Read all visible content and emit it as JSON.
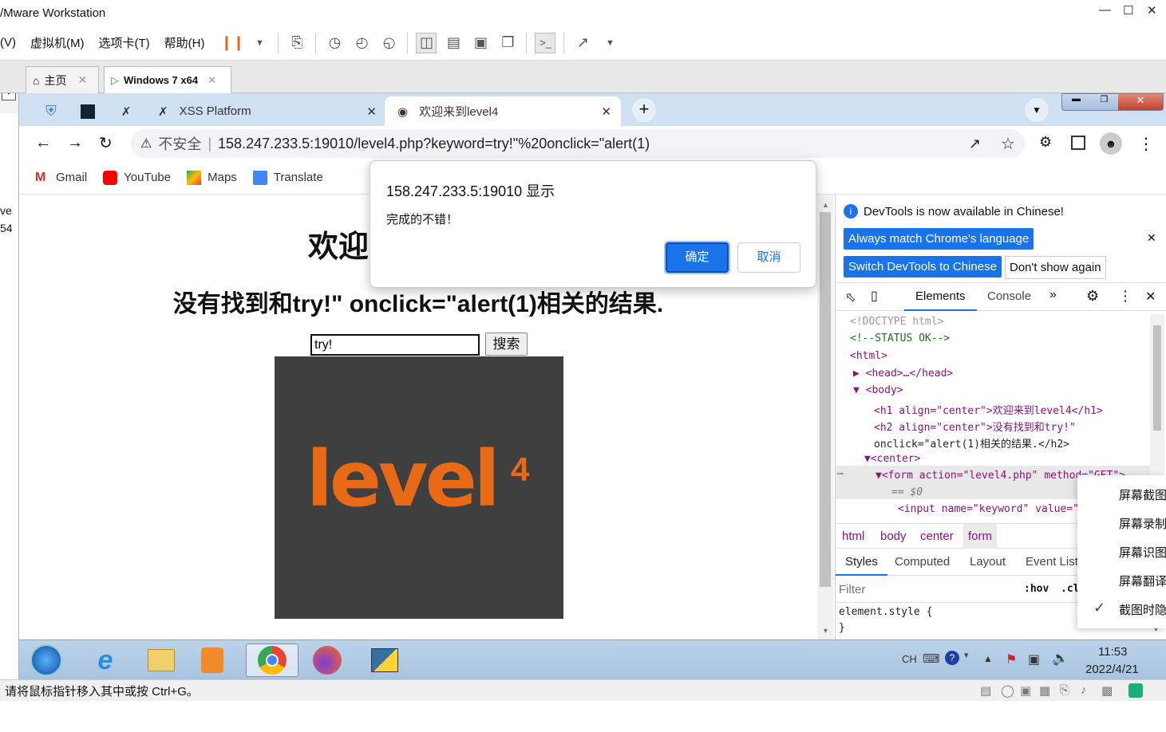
{
  "vmware": {
    "title": "/Mware Workstation",
    "menu": [
      "(V)",
      "虚拟机(M)",
      "选项卡(T)",
      "帮助(H)"
    ],
    "tabs": [
      {
        "label": "主页"
      },
      {
        "label": "Windows 7 x64"
      }
    ],
    "left_labels": [
      "ve",
      "54"
    ],
    "status": "请将鼠标指针移入其中或按 Ctrl+G。"
  },
  "chrome": {
    "tabs": [
      {
        "label": ""
      },
      {
        "label": ""
      },
      {
        "label": ""
      },
      {
        "label": "XSS Platform"
      },
      {
        "label": "欢迎来到level4"
      }
    ],
    "not_secure": "不安全",
    "url": "158.247.233.5:19010/level4.php?keyword=try!\"%20onclick=\"alert(1)",
    "bookmarks": [
      {
        "label": "Gmail",
        "icon": "gmail-icon"
      },
      {
        "label": "YouTube",
        "icon": "youtube-icon"
      },
      {
        "label": "Maps",
        "icon": "maps-icon"
      },
      {
        "label": "Translate",
        "icon": "translate-icon"
      }
    ]
  },
  "page": {
    "h1": "欢迎",
    "h2": "没有找到和try!\" onclick=\"alert(1)相关的结果.",
    "input_value": "try!",
    "search_button": "搜索",
    "image_text": "level",
    "image_sup": "4"
  },
  "alert": {
    "title": "158.247.233.5:19010 显示",
    "message": "完成的不错！",
    "ok": "确定",
    "cancel": "取消"
  },
  "devtools": {
    "info": "DevTools is now available in Chinese!",
    "btn_match": "Always match Chrome's language",
    "btn_switch": "Switch DevTools to Chinese",
    "btn_dont": "Don't show again",
    "tabs": [
      "Elements",
      "Console"
    ],
    "dom_lines": [
      "<!DOCTYPE html>",
      "<!--STATUS OK-->",
      "<html>",
      "<head>…</head>",
      "<body>",
      "<h1 align=\"center\">欢迎来到level4</h1>",
      "<h2 align=\"center\">没有找到和try!\"",
      "onclick=\"alert(1)相关的结果.</h2>",
      "<center>",
      "<form action=\"level4.php\" method=\"GET\">",
      "== $0",
      "<input name=\"keyword\" value=\"try!\""
    ],
    "breadcrumbs": [
      "html",
      "body",
      "center",
      "form"
    ],
    "style_tabs": [
      "Styles",
      "Computed",
      "Layout",
      "Event Listeners"
    ],
    "filter_placeholder": "Filter",
    "hov": ":hov",
    "cls": ".cls",
    "element_style": "element.style {",
    "element_style_close": "}"
  },
  "context_menu": [
    "屏幕截图",
    "屏幕录制",
    "屏幕识图",
    "屏幕翻译",
    "截图时隐"
  ],
  "taskbar": {
    "lang": "CH",
    "time": "11:53",
    "date": "2022/4/21"
  }
}
